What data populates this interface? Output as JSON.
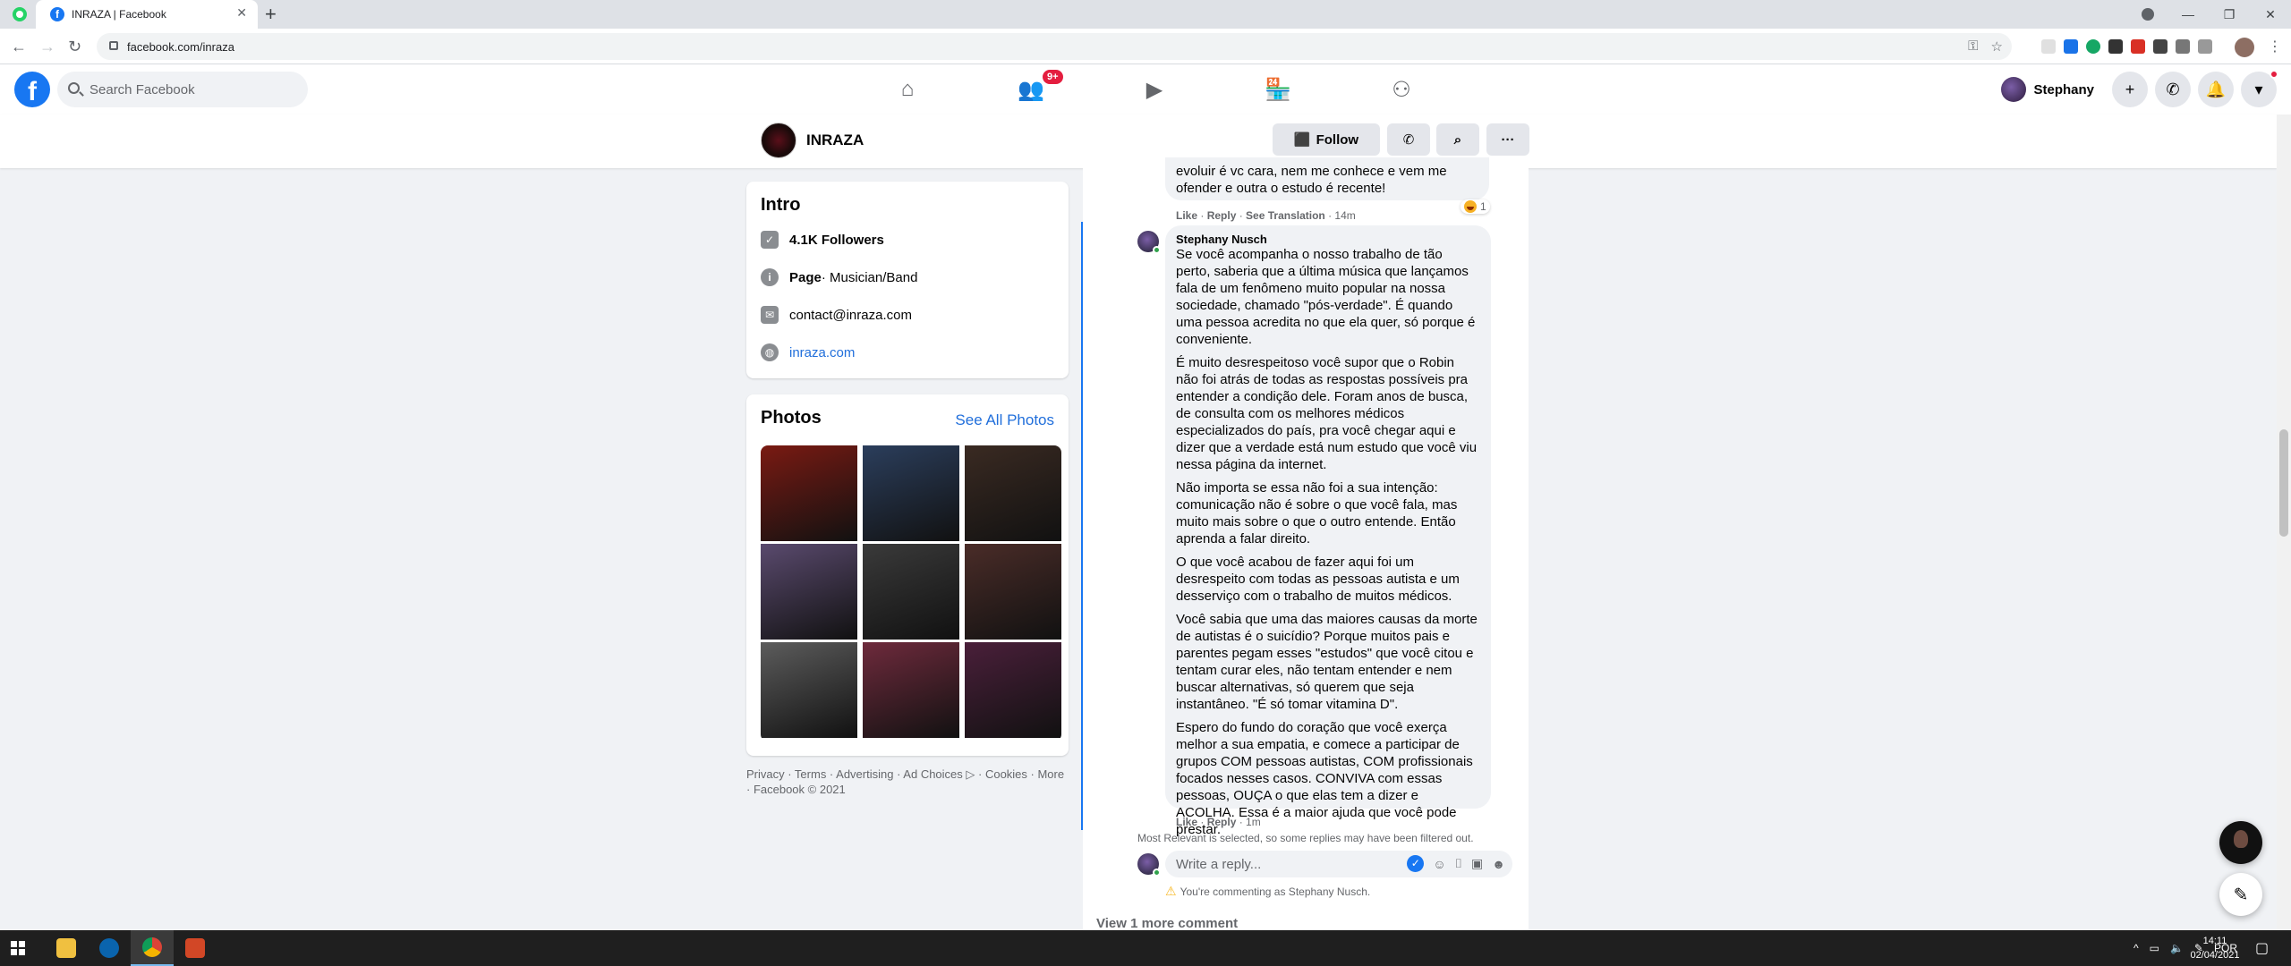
{
  "browser": {
    "tab_title": "INRAZA | Facebook",
    "url": "facebook.com/inraza"
  },
  "fb_nav": {
    "search_placeholder": "Search Facebook",
    "friends_badge": "9+",
    "user_name": "Stephany"
  },
  "page_header": {
    "name": "INRAZA",
    "follow_label": "Follow"
  },
  "intro": {
    "title": "Intro",
    "followers": "4.1K Followers",
    "category_label": "Page",
    "category_value": " · Musician/Band",
    "email": "contact@inraza.com",
    "website": "inraza.com"
  },
  "photos": {
    "title": "Photos",
    "see_all": "See All Photos",
    "colors": [
      "#7a1a12",
      "#2b3e5c",
      "#3a2a22",
      "#5a4a6e",
      "#3a3a3a",
      "#4a2c28",
      "#5c5c5c",
      "#6e2a3c",
      "#4a1f3a"
    ]
  },
  "footer": {
    "text": "Privacy · Terms · Advertising · Ad Choices ▷ · Cookies · More · Facebook © 2021"
  },
  "thread": {
    "prev_comment_tail": "evoluir é vc cara, nem me conhece e vem me ofender e outra o estudo é recente!",
    "prev_actions": {
      "like": "Like",
      "reply": "Reply",
      "translate": "See Translation",
      "time": "14m"
    },
    "prev_reaction_count": "1",
    "reply_author": "Stephany Nusch",
    "reply_paragraphs": [
      "Se você acompanha o nosso trabalho de tão perto, saberia que a última música que lançamos fala de um fenômeno muito popular na nossa sociedade, chamado \"pós-verdade\". É quando uma pessoa acredita no que ela quer, só porque é conveniente.",
      "É muito desrespeitoso você supor que o Robin não foi atrás de todas as respostas possíveis pra entender a condição dele. Foram anos de busca, de consulta com os melhores médicos especializados do país, pra você chegar aqui e dizer que a verdade está num estudo que você viu nessa página da internet.",
      "Não importa se essa não foi a sua intenção: comunicação não é sobre o que você fala, mas muito mais sobre o que o outro entende. Então aprenda a falar direito.",
      "O que você acabou de fazer aqui foi um desrespeito com todas as pessoas autista e um desserviço com o trabalho de muitos médicos.",
      "Você sabia que uma das maiores causas da morte de autistas é o suicídio? Porque muitos pais e parentes pegam esses \"estudos\" que você citou e tentam curar eles, não tentam entender e nem buscar alternativas, só querem que seja instantâneo. \"É só tomar vitamina D\".",
      "Espero do fundo do coração que você exerça melhor a sua empatia, e comece a participar de grupos COM pessoas autistas, COM profissionais focados nesses casos. CONVIVA com essas pessoas, OUÇA o que elas tem a dizer e ACOLHA. Essa é a maior ajuda que você pode prestar."
    ],
    "reply_actions": {
      "like": "Like",
      "reply": "Reply",
      "time": "1m"
    },
    "filter_note": "Most Relevant is selected, so some replies may have been filtered out.",
    "reply_placeholder": "Write a reply...",
    "commenting_as": "You're commenting as Stephany Nusch.",
    "view_more": "View 1 more comment"
  },
  "taskbar": {
    "lang": "POR",
    "time": "14:11",
    "date": "02/04/2021"
  }
}
